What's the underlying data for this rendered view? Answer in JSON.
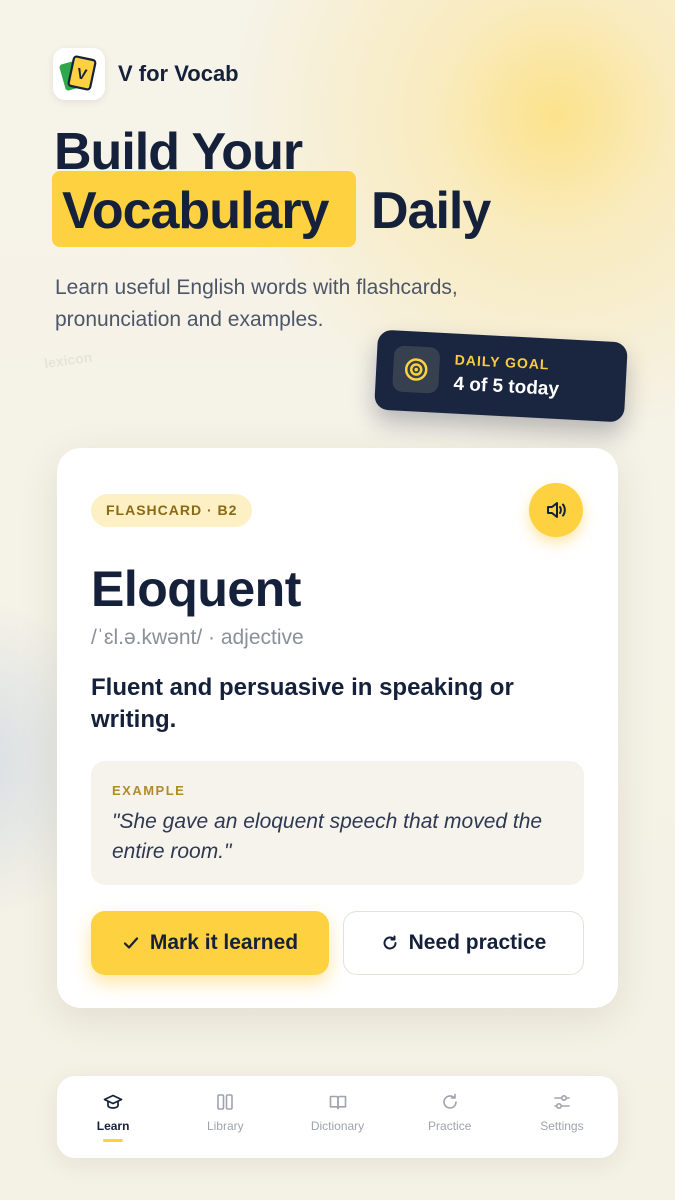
{
  "app": {
    "name": "V for Vocab",
    "logo_letter": "V"
  },
  "hero": {
    "title_line1": "Build Your",
    "title_highlight": "Vocabulary",
    "title_rest": "Daily",
    "subtitle": "Learn useful English words with flashcards, pronunciation and examples.",
    "watermark": "lexicon"
  },
  "daily_goal": {
    "label": "DAILY GOAL",
    "value": "4 of 5 today",
    "icon": "target-icon"
  },
  "flashcard": {
    "chip": "FLASHCARD · B2",
    "word": "Eloquent",
    "phonetic": "/ˈɛl.ə.kwənt/ · adjective",
    "definition": "Fluent and persuasive in speaking or writing.",
    "example_label": "EXAMPLE",
    "example_text": "\"She gave an eloquent speech that moved the entire room.\"",
    "learned_label": "Mark it learned",
    "practice_label": "Need practice",
    "speaker_icon": "speaker-icon"
  },
  "nav": {
    "items": [
      {
        "label": "Learn",
        "icon": "graduation-cap-icon",
        "active": true
      },
      {
        "label": "Library",
        "icon": "library-icon",
        "active": false
      },
      {
        "label": "Dictionary",
        "icon": "book-icon",
        "active": false
      },
      {
        "label": "Practice",
        "icon": "refresh-icon",
        "active": false
      },
      {
        "label": "Settings",
        "icon": "sliders-icon",
        "active": false
      }
    ]
  },
  "colors": {
    "accent": "#fdd13f",
    "ink": "#15213a",
    "dark_card": "#1a2540"
  }
}
